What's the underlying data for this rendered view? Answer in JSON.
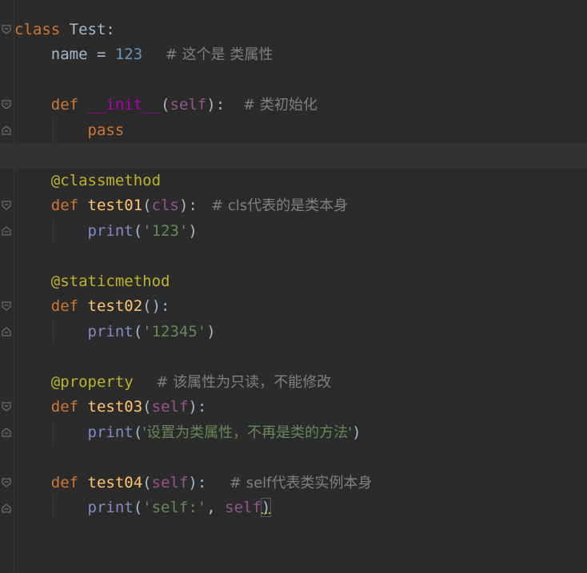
{
  "code": {
    "l1_kw": "class",
    "l1_name": " Test",
    "l1_colon": ":",
    "l2_ind": "    ",
    "l2_name": "name",
    "l2_eq": " = ",
    "l2_num": "123",
    "l2_cmt": "     # 这个是 类属性",
    "l4_ind": "    ",
    "l4_def": "def",
    "l4_fn": " __init__",
    "l4_open": "(",
    "l4_self": "self",
    "l4_close": "):",
    "l4_cmt": "    # 类初始化",
    "l5_ind": "        ",
    "l5_pass": "pass",
    "l7_ind": "    ",
    "l7_deco": "@classmethod",
    "l8_ind": "    ",
    "l8_def": "def",
    "l8_fn": " test01",
    "l8_open": "(",
    "l8_cls": "cls",
    "l8_close": "):",
    "l8_cmt": "   # cls代表的是类本身",
    "l9_ind": "        ",
    "l9_print": "print",
    "l9_open": "(",
    "l9_str": "'123'",
    "l9_close": ")",
    "l11_ind": "    ",
    "l11_deco": "@staticmethod",
    "l12_ind": "    ",
    "l12_def": "def",
    "l12_fn": " test02",
    "l12_rest": "():",
    "l13_ind": "        ",
    "l13_print": "print",
    "l13_open": "(",
    "l13_str": "'12345'",
    "l13_close": ")",
    "l15_ind": "    ",
    "l15_deco": "@property",
    "l15_cmt": "     # 该属性为只读，不能修改",
    "l16_ind": "    ",
    "l16_def": "def",
    "l16_fn": " test03",
    "l16_open": "(",
    "l16_self": "self",
    "l16_close": "):",
    "l17_ind": "        ",
    "l17_print": "print",
    "l17_open": "(",
    "l17_str": "'设置为类属性，不再是类的方法'",
    "l17_close": ")",
    "l19_ind": "    ",
    "l19_def": "def",
    "l19_fn": " test04",
    "l19_open": "(",
    "l19_self": "self",
    "l19_close": "):",
    "l19_cmt": "     # self代表类实例本身",
    "l20_ind": "        ",
    "l20_print": "print",
    "l20_open": "(",
    "l20_str": "'self:'",
    "l20_comma": ", ",
    "l20_self": "self",
    "l20_close": ")"
  },
  "colors": {
    "background": "#2b2b2b",
    "keyword": "#cc7832",
    "function": "#ffc66d",
    "self": "#94558d",
    "number": "#6897bb",
    "string": "#6a8759",
    "comment": "#808080",
    "decorator": "#bbb529",
    "builtin": "#8888c6"
  },
  "icons": {
    "fold_open": "fold-open-icon",
    "fold_close": "fold-close-icon"
  }
}
